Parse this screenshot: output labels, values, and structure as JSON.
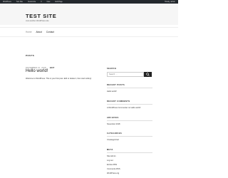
{
  "admin_bar": {
    "items": [
      "WordPress",
      "Test Site",
      "Customize",
      "0",
      "New",
      "Edit Page"
    ],
    "greeting": "Howdy, admin"
  },
  "site": {
    "title": "TEST SITE",
    "tagline": "Just another WordPress site"
  },
  "nav": {
    "items": [
      "Home",
      "About",
      "Contact"
    ],
    "current": "Home"
  },
  "main": {
    "heading": "POSTS",
    "post": {
      "date": "NOVEMBER 21, 2018",
      "edit_label": "EDIT",
      "title": "Hello world!",
      "excerpt": "Welcome to WordPress. This is your first post. Edit or delete it, then start writing!"
    }
  },
  "sidebar": {
    "search_placeholder": "Search …",
    "recent_posts": {
      "title": "RECENT POSTS",
      "items": [
        "Hello world!"
      ]
    },
    "recent_comments": {
      "title": "RECENT COMMENTS",
      "items": [
        "A WordPress Commenter on Hello world!"
      ]
    },
    "archives": {
      "title": "ARCHIVES",
      "items": [
        "November 2018"
      ]
    },
    "categories": {
      "title": "CATEGORIES",
      "items": [
        "Uncategorized"
      ]
    },
    "meta": {
      "title": "META",
      "items": [
        "Site Admin",
        "Log out",
        "Entries RSS",
        "Comments RSS",
        "WordPress.org"
      ]
    }
  },
  "colors": {
    "admin_bar_bg": "#23282d",
    "header_bg": "#f6f6f6",
    "text": "#333333",
    "button_bg": "#222222"
  }
}
